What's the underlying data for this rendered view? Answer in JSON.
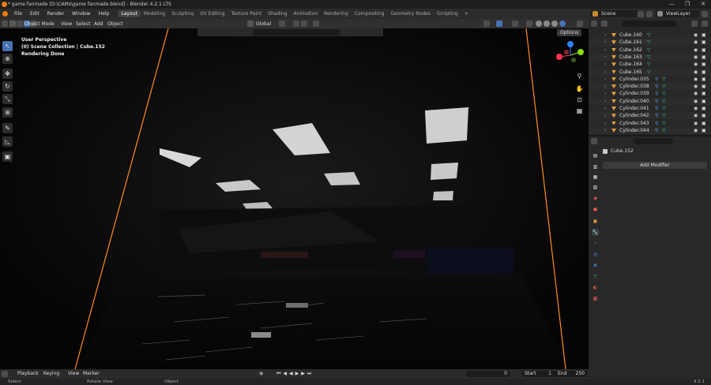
{
  "window": {
    "title": "* game fanmade [D:\\CAMs\\game fanmade.blend] - Blender 4.2.1 LTS",
    "controls": [
      "—",
      "❐",
      "✕"
    ]
  },
  "menu": [
    "File",
    "Edit",
    "Render",
    "Window",
    "Help"
  ],
  "workspaces": [
    {
      "label": "Layout",
      "active": true
    },
    {
      "label": "Modeling"
    },
    {
      "label": "Sculpting"
    },
    {
      "label": "UV Editing"
    },
    {
      "label": "Texture Paint"
    },
    {
      "label": "Shading"
    },
    {
      "label": "Animation"
    },
    {
      "label": "Rendering"
    },
    {
      "label": "Compositing"
    },
    {
      "label": "Geometry Nodes"
    },
    {
      "label": "Scripting"
    }
  ],
  "add_workspace": "+",
  "scene_name": "Scene",
  "view_layer": "ViewLayer",
  "viewport_header": {
    "mode": "Object Mode",
    "menus": [
      "View",
      "Select",
      "Add",
      "Object"
    ],
    "transform": "Global",
    "options": "Options"
  },
  "overlay": {
    "line1": "User Perspective",
    "line2": "(0) Scene Collection | Cube.152",
    "line3": "Rendering Done"
  },
  "outliner": {
    "items": [
      {
        "name": "Cube.160",
        "type": "mesh"
      },
      {
        "name": "Cube.161",
        "type": "mesh"
      },
      {
        "name": "Cube.162",
        "type": "mesh"
      },
      {
        "name": "Cube.163",
        "type": "mesh"
      },
      {
        "name": "Cube.164",
        "type": "mesh"
      },
      {
        "name": "Cube.165",
        "type": "mesh"
      },
      {
        "name": "Cylinder.035",
        "type": "modmesh"
      },
      {
        "name": "Cylinder.038",
        "type": "modmesh"
      },
      {
        "name": "Cylinder.039",
        "type": "modmesh"
      },
      {
        "name": "Cylinder.040",
        "type": "modmesh"
      },
      {
        "name": "Cylinder.041",
        "type": "modmesh"
      },
      {
        "name": "Cylinder.042",
        "type": "modmesh"
      },
      {
        "name": "Cylinder.043",
        "type": "modmesh"
      },
      {
        "name": "Cylinder.044",
        "type": "modmesh"
      }
    ]
  },
  "properties": {
    "object_name": "Cube.152",
    "add_modifier": "Add Modifier"
  },
  "timeline": {
    "menus": [
      "Playback",
      "Keying",
      "View",
      "Marker"
    ],
    "current_frame": "0",
    "start_label": "Start",
    "start": "1",
    "end_label": "End",
    "end": "250"
  },
  "status": {
    "select": "Select",
    "rotate": "Rotate View",
    "object": "Object",
    "version": "4.2.1"
  },
  "colors": {
    "accent": "#4772b3",
    "selection": "#ff8a1e",
    "mesh_icon": "#3fc7a8",
    "object_icon": "#e8a03a"
  }
}
